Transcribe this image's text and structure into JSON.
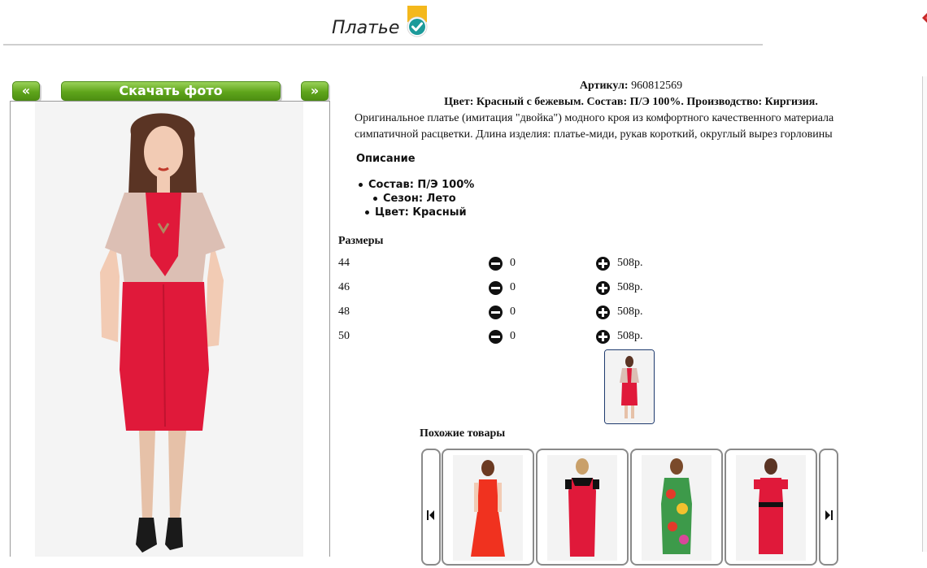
{
  "header": {
    "title": "Платье"
  },
  "gallery": {
    "prev_label": "«",
    "download_label": "Скачать фото",
    "next_label": "»"
  },
  "product": {
    "article_label": "Артикул:",
    "article_value": "960812569",
    "summary": "Цвет: Красный с бежевым. Состав: П/Э 100%. Производство: Киргизия.",
    "description_line1": "Оригинальное платье (имитация \"двойка\") модного кроя из комфортного качественного материала",
    "description_line2": "симпатичной расцветки. Длина изделия: платье-миди, рукав короткий, округлый вырез горловины",
    "description_heading": "Описание",
    "properties": [
      "Состав: П/Э 100%",
      "Сезон: Лето",
      "Цвет: Красный"
    ]
  },
  "sizes": {
    "title": "Размеры",
    "rows": [
      {
        "size": "44",
        "qty": "0",
        "price": "508р."
      },
      {
        "size": "46",
        "qty": "0",
        "price": "508р."
      },
      {
        "size": "48",
        "qty": "0",
        "price": "508р."
      },
      {
        "size": "50",
        "qty": "0",
        "price": "508р."
      }
    ]
  },
  "similar": {
    "title": "Похожие товары"
  },
  "colors": {
    "button_green": "#5fa51b",
    "dress_red": "#e0193a",
    "jacket_beige": "#dcbfb4",
    "thumb_border": "#1e3a6e"
  },
  "icons": {
    "title_badge": "check-badge-icon",
    "close": "close-icon",
    "minus": "minus-circle-icon",
    "plus": "plus-circle-icon",
    "carousel_prev": "skip-previous-icon",
    "carousel_next": "skip-next-icon"
  }
}
